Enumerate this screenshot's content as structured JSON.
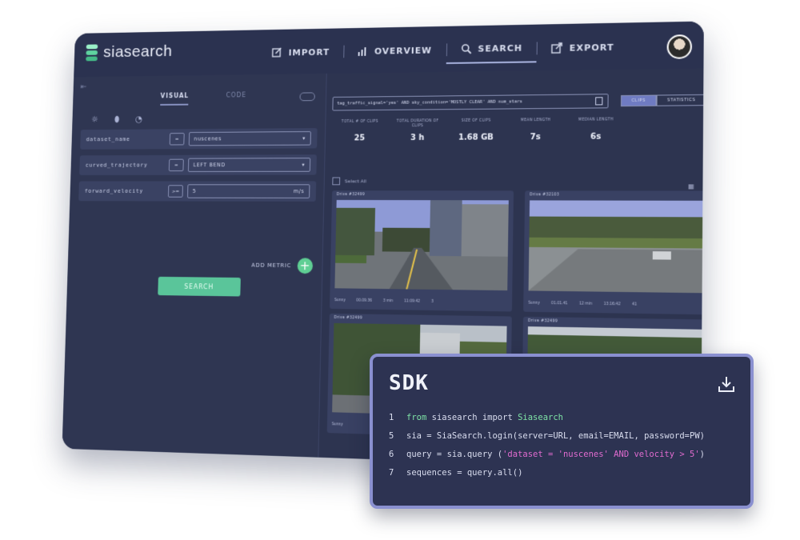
{
  "app": {
    "logo_text": "siasearch",
    "nav": [
      {
        "label": "IMPORT",
        "icon": "edit-icon"
      },
      {
        "label": "OVERVIEW",
        "icon": "bar-chart-icon"
      },
      {
        "label": "SEARCH",
        "icon": "search-icon",
        "active": true
      },
      {
        "label": "EXPORT",
        "icon": "export-icon"
      }
    ]
  },
  "left": {
    "tabs": [
      "VISUAL",
      "CODE"
    ],
    "rows": [
      {
        "label": "dataset_name",
        "op": "=",
        "value": "nuscenes"
      },
      {
        "label": "curved_trajectory",
        "op": "=",
        "value": "LEFT BEND"
      },
      {
        "label": "forward_velocity",
        "op": ">=",
        "value": "5",
        "unit": "m/s"
      }
    ],
    "add_metric": "ADD METRIC",
    "search_button": "SEARCH"
  },
  "right": {
    "query": "tag_traffic_signal='yes' AND sky_condition='MOSTLY CLEAR' AND num_stars",
    "toggle": [
      "CLIPS",
      "STATISTICS"
    ],
    "stats": [
      {
        "label": "TOTAL # OF CLIPS",
        "value": "25"
      },
      {
        "label": "TOTAL DURATION OF CLIPS",
        "value": "3 h"
      },
      {
        "label": "SIZE OF CLIPS",
        "value": "1.68 GB"
      },
      {
        "label": "MEAN LENGTH",
        "value": "7s"
      },
      {
        "label": "MEDIAN LENGTH",
        "value": "6s"
      }
    ],
    "select_all": "Select All",
    "cards": [
      {
        "title": "Drive #32499",
        "meta": [
          "Sunny",
          "00.09.36",
          "3 min",
          "11:09:42",
          "3"
        ]
      },
      {
        "title": "Drive #32103",
        "meta": [
          "Sunny",
          "01.01.41",
          "12 min",
          "13:16:42",
          "41"
        ]
      },
      {
        "title": "Drive #32499",
        "meta": [
          "Sunny"
        ]
      },
      {
        "title": "Drive #32499",
        "meta": []
      }
    ]
  },
  "sdk": {
    "title": "SDK",
    "lines": [
      {
        "num": "1",
        "parts": [
          {
            "t": "from",
            "c": "kw"
          },
          {
            "t": " siasearch import ",
            "c": ""
          },
          {
            "t": "Siasearch",
            "c": "kw"
          }
        ]
      },
      {
        "num": "5",
        "parts": [
          {
            "t": "sia = SiaSearch.login(server=URL, email=EMAIL, password=PW)",
            "c": ""
          }
        ]
      },
      {
        "num": "6",
        "parts": [
          {
            "t": "query = sia.query (",
            "c": ""
          },
          {
            "t": "'dataset = 'nuscenes' AND velocity > 5'",
            "c": "str"
          },
          {
            "t": ")",
            "c": ""
          }
        ]
      },
      {
        "num": "7",
        "parts": [
          {
            "t": "sequences = query.all()",
            "c": ""
          }
        ]
      }
    ]
  }
}
